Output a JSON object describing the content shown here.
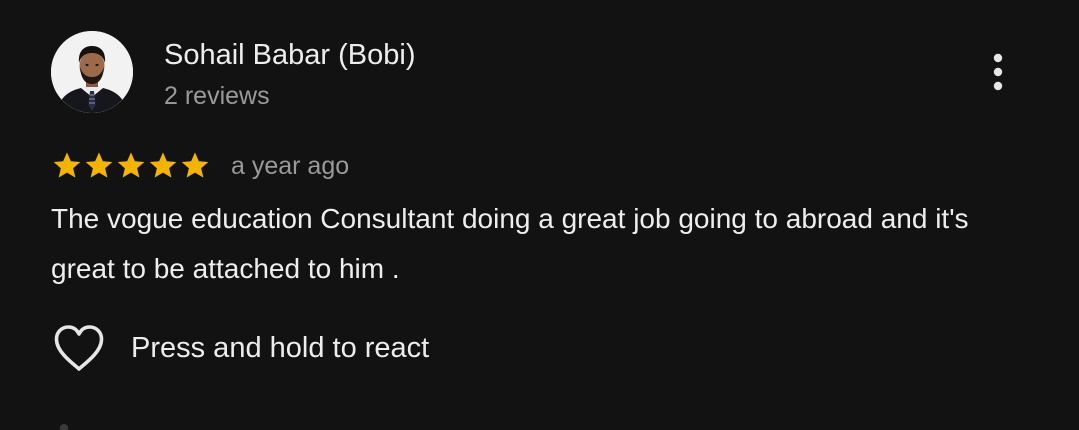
{
  "reviewer": {
    "name": "Sohail Babar (Bobi)",
    "meta": "2 reviews",
    "avatar_icon": "profile-photo"
  },
  "menu": {
    "icon": "more-vertical-icon"
  },
  "review": {
    "rating": 5,
    "rating_max": 5,
    "date": "a year ago",
    "text": "The vogue education Consultant doing a great job going to abroad and it's great to be attached to him ."
  },
  "reaction": {
    "icon": "heart-outline-icon",
    "label": "Press and hold to react"
  },
  "colors": {
    "background": "#121212",
    "star": "#f4b400",
    "primary_text": "#ededed",
    "secondary_text": "#9a9a9a"
  }
}
